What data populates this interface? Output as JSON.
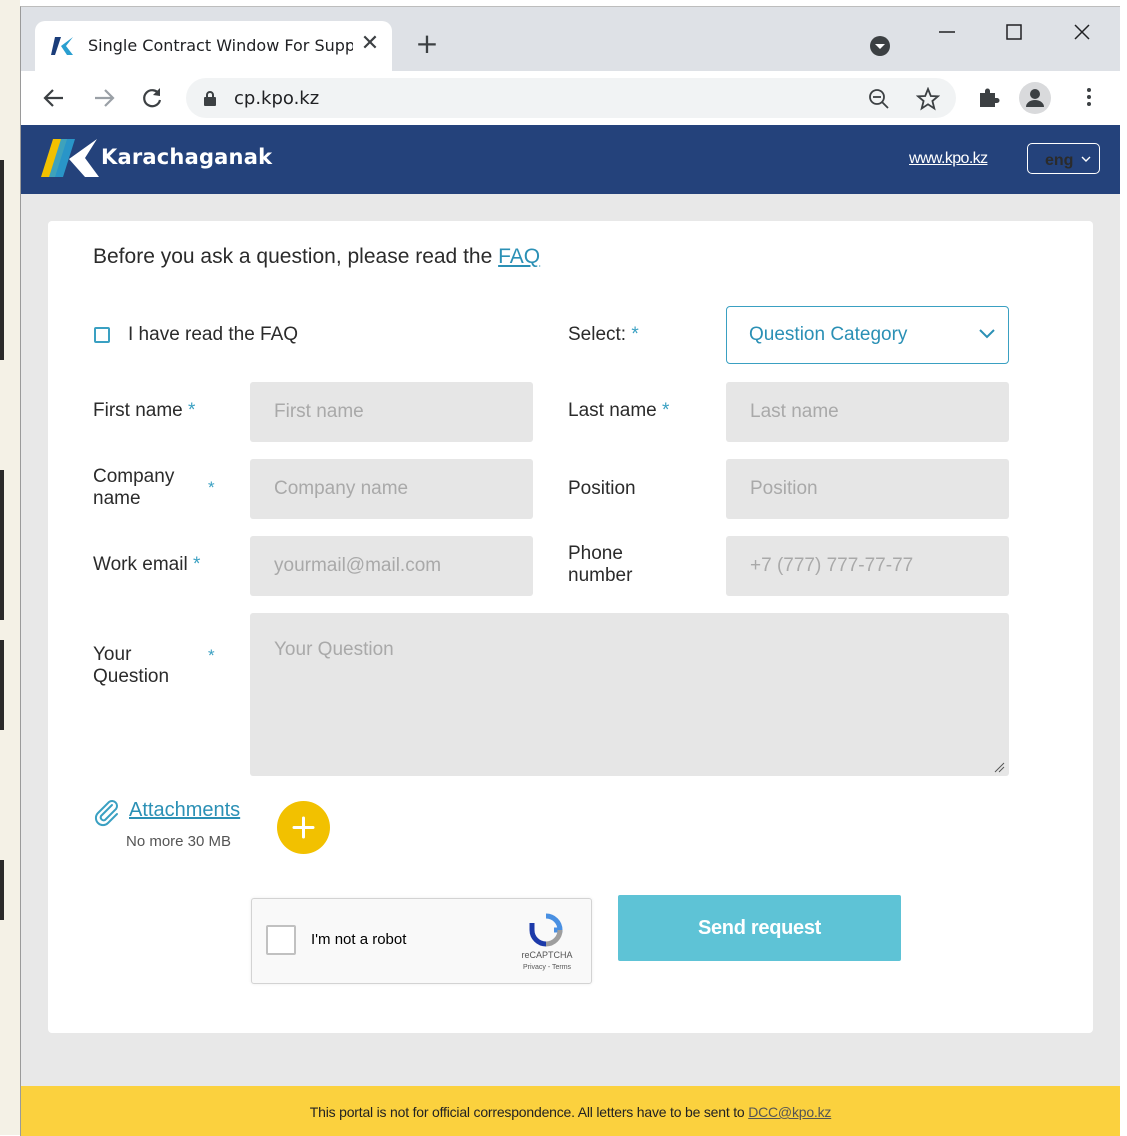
{
  "browser": {
    "tab_title": "Single Contract Window For Supp",
    "url": "cp.kpo.kz"
  },
  "header": {
    "brand": "Karachaganak",
    "site_link": "www.kpo.kz",
    "language": "eng"
  },
  "form": {
    "intro_text": "Before you ask a question, please read the ",
    "faq_link": "FAQ",
    "faq_checkbox_label": "I have read the FAQ",
    "select_label": "Select:",
    "select_value": "Question Category",
    "first_name_label": "First name",
    "first_name_placeholder": "First name",
    "last_name_label": "Last name",
    "last_name_placeholder": "Last name",
    "company_label_1": "Company",
    "company_label_2": "name",
    "company_placeholder": "Company name",
    "position_label": "Position",
    "position_placeholder": "Position",
    "email_label": "Work email",
    "email_placeholder": "yourmail@mail.com",
    "phone_label_1": "Phone",
    "phone_label_2": "number",
    "phone_placeholder": "+7 (777) 777-77-77",
    "question_label_1": "Your",
    "question_label_2": "Question",
    "question_placeholder": "Your Question",
    "required_mark": "*",
    "attachments_label": "Attachments",
    "attachments_hint": "No more 30 MB",
    "captcha_label": "I'm not a robot",
    "captcha_brand": "reCAPTCHA",
    "captcha_terms": "Privacy - Terms",
    "submit_label": "Send request"
  },
  "footer": {
    "notice": "This portal is not for official correspondence. All letters have to be sent to ",
    "email": "DCC@kpo.kz"
  },
  "colors": {
    "header_bg": "#24427b",
    "accent": "#3aa0c2",
    "submit_bg": "#5ec3d6",
    "add_button": "#f2c100",
    "footer_bg": "#fbd13e"
  }
}
